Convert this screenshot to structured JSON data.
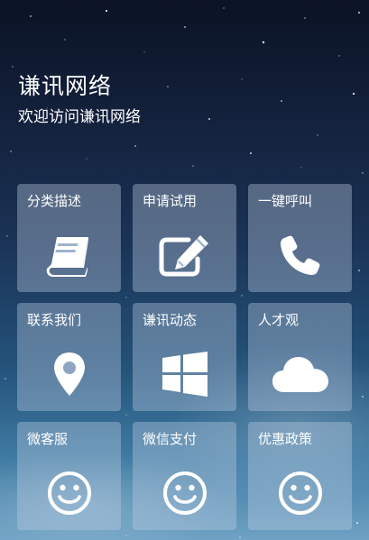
{
  "header": {
    "title": "谦讯网络",
    "subtitle": "欢迎访问谦讯网络"
  },
  "tiles": [
    {
      "label": "分类描述",
      "icon": "book-icon"
    },
    {
      "label": "申请试用",
      "icon": "edit-icon"
    },
    {
      "label": "一键呼叫",
      "icon": "phone-icon"
    },
    {
      "label": "联系我们",
      "icon": "map-marker-icon"
    },
    {
      "label": "谦讯动态",
      "icon": "windows-icon"
    },
    {
      "label": "人才观",
      "icon": "cloud-icon"
    },
    {
      "label": "微客服",
      "icon": "smile-icon"
    },
    {
      "label": "微信支付",
      "icon": "smile-icon"
    },
    {
      "label": "优惠政策",
      "icon": "smile-icon"
    }
  ],
  "colors": {
    "tile_background": "#becde1",
    "text": "#ffffff"
  }
}
